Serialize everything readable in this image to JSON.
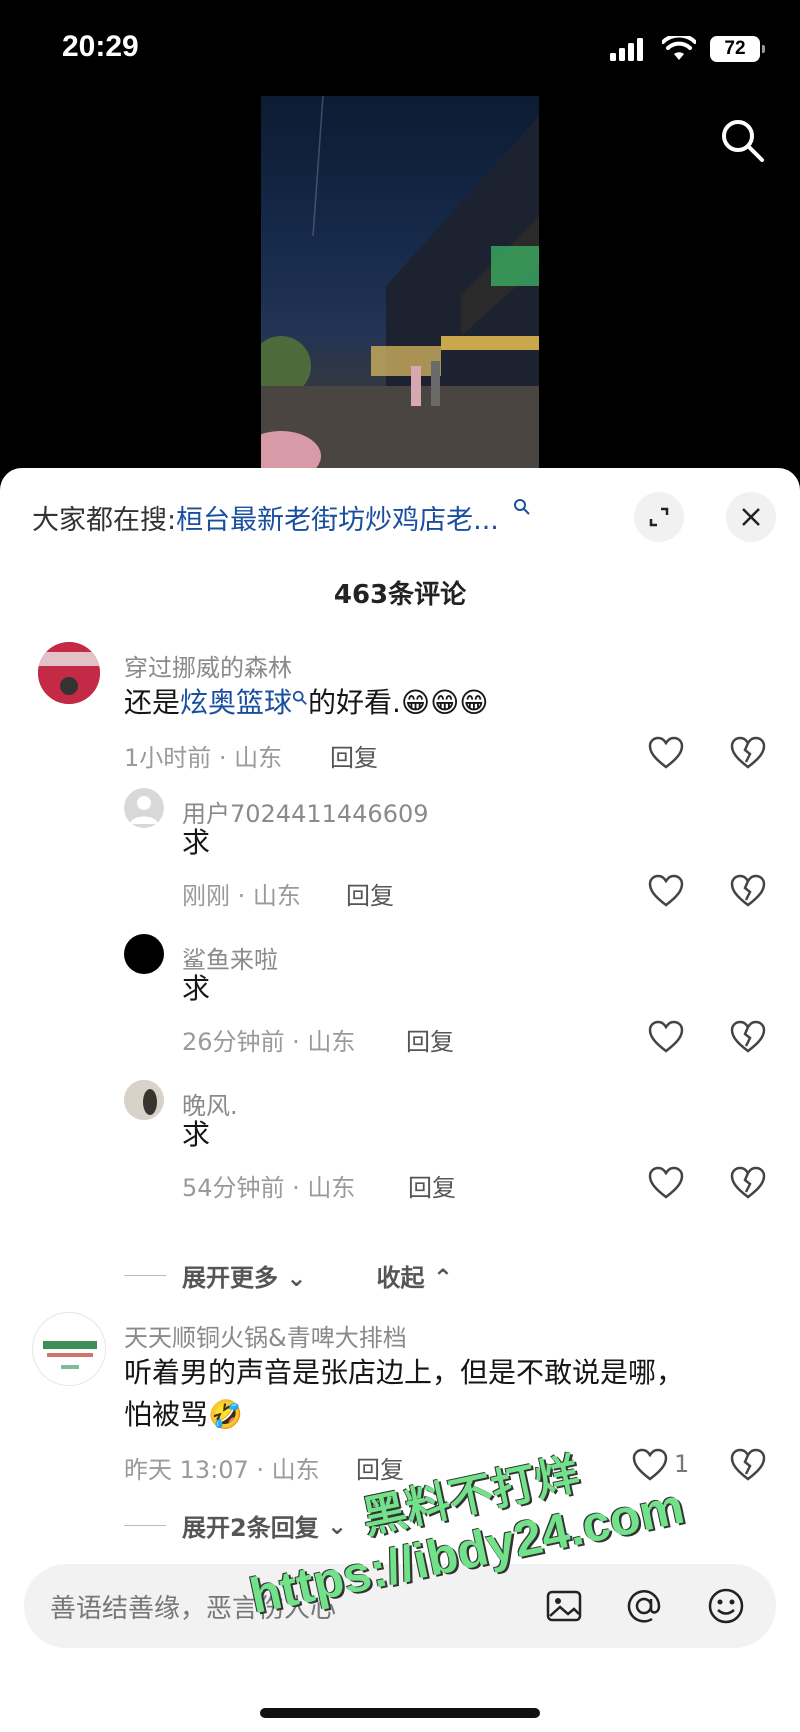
{
  "status_bar": {
    "time": "20:29",
    "battery": "72"
  },
  "hot_search": {
    "prefix": "大家都在搜:",
    "term": "桓台最新老街坊炒鸡店老..."
  },
  "comments_count": "463条评论",
  "comments": [
    {
      "user": "穿过挪威的森林",
      "text_before": "还是",
      "link": "炫奥篮球",
      "text_after": "的好看.😁😁😁",
      "meta": "1小时前 · 山东",
      "reply": "回复"
    },
    {
      "user": "用户7024411446609",
      "text": "求",
      "meta": "刚刚 · 山东",
      "reply": "回复"
    },
    {
      "user": "鲨鱼来啦",
      "text": "求",
      "meta": "26分钟前 · 山东",
      "reply": "回复"
    },
    {
      "user": "晚风.",
      "text": "求",
      "meta": "54分钟前 · 山东",
      "reply": "回复"
    },
    {
      "user": "天天顺铜火锅&青啤大排档",
      "text_line1": "听着男的声音是张店边上，但是不敢说是哪，",
      "text_line2": "怕被骂🤣",
      "meta": "昨天 13:07 · 山东",
      "reply": "回复",
      "likes": "1"
    }
  ],
  "expand_more": "展开更多",
  "collapse": "收起",
  "expand_replies": "展开2条回复",
  "input_placeholder": "善语结善缘，恶言伤人心",
  "watermark": {
    "line1": "黑料不打烊",
    "line2": "https://ibdy24.com"
  },
  "icons": [
    "search-icon",
    "expand-icon",
    "close-icon",
    "heart-icon",
    "broken-heart-icon",
    "image-icon",
    "at-icon",
    "emoji-icon"
  ]
}
